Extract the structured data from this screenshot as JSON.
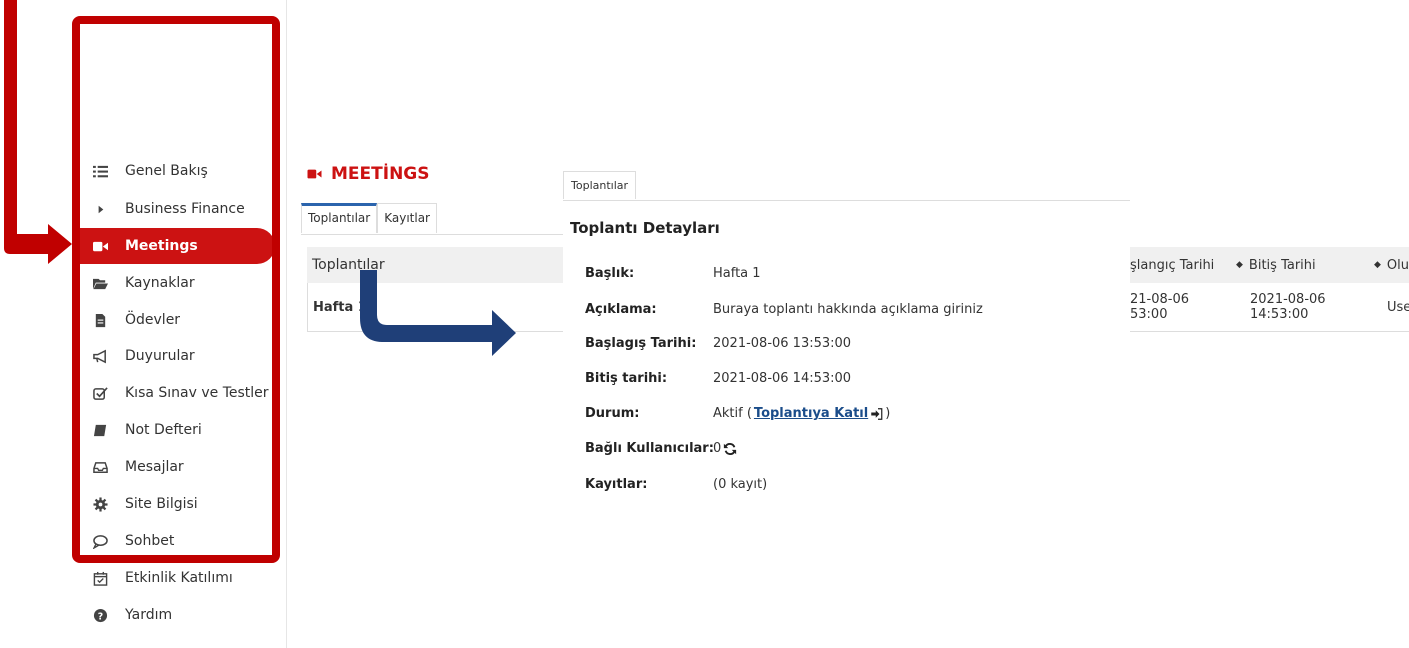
{
  "sidebar": {
    "items": [
      {
        "label": "Genel Bakış",
        "icon": "list-icon"
      },
      {
        "label": "Business Finance",
        "icon": "caret-right-icon"
      },
      {
        "label": "Meetings",
        "icon": "video-camera-icon",
        "active": true
      },
      {
        "label": "Kaynaklar",
        "icon": "folder-open-icon"
      },
      {
        "label": "Ödevler",
        "icon": "file-icon"
      },
      {
        "label": "Duyurular",
        "icon": "bullhorn-icon"
      },
      {
        "label": "Kısa Sınav ve Testler",
        "icon": "checkbox-icon"
      },
      {
        "label": "Not Defteri",
        "icon": "book-icon"
      },
      {
        "label": "Mesajlar",
        "icon": "inbox-icon"
      },
      {
        "label": "Site Bilgisi",
        "icon": "gear-icon"
      },
      {
        "label": "Sohbet",
        "icon": "chat-icon"
      },
      {
        "label": "Etkinlik Katılımı",
        "icon": "calendar-check-icon"
      },
      {
        "label": "Yardım",
        "icon": "question-icon"
      }
    ]
  },
  "main": {
    "title": "MEETİNGS",
    "tabs": [
      "Toplantılar",
      "Kayıtlar"
    ],
    "table": {
      "header": "Toplantılar",
      "row": "Hafta 1"
    }
  },
  "right_table": {
    "headers": [
      "şlangıç Tarihi",
      "Bitiş Tarihi",
      "Olu"
    ],
    "row": {
      "start_date": "21-08-06",
      "start_time": "53:00",
      "end_date": "2021-08-06",
      "end_time": "14:53:00",
      "creator": "Use"
    }
  },
  "popup": {
    "tab": "Toplantılar",
    "title": "Toplantı Detayları",
    "details": {
      "title_label": "Başlık:",
      "title_value": "Hafta 1",
      "desc_label": "Açıklama:",
      "desc_value": "Buraya toplantı hakkında açıklama giriniz",
      "start_label": "Başlagış Tarihi:",
      "start_value": "2021-08-06 13:53:00",
      "end_label": "Bitiş tarihi:",
      "end_value": "2021-08-06 14:53:00",
      "status_label": "Durum:",
      "status_prefix": "Aktif (",
      "status_link": "Toplantıya Katıl",
      "status_suffix": ")",
      "users_label": "Bağlı Kullanıcılar:",
      "users_value": "0",
      "records_label": "Kayıtlar:",
      "records_value": "(0 kayıt)"
    }
  },
  "colors": {
    "accent_red": "#cc1212",
    "annotation_red": "#c00000",
    "annotation_blue": "#1f3f78",
    "link_blue": "#1a4c8a",
    "tab_blue": "#2b64ad"
  }
}
